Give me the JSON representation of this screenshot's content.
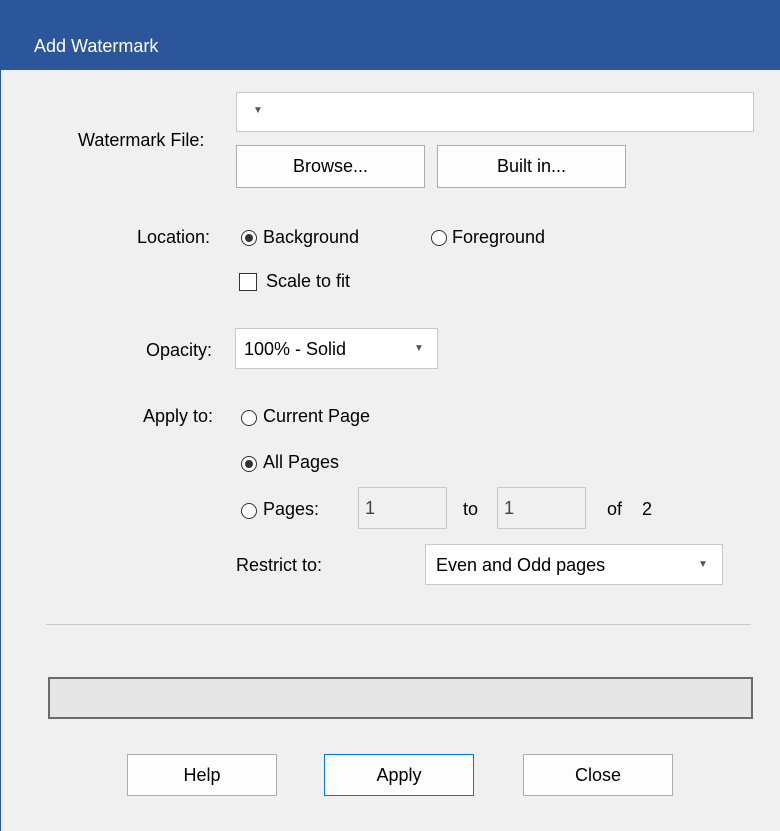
{
  "window": {
    "title": "Add Watermark"
  },
  "watermark_file": {
    "label": "Watermark File:",
    "value": ""
  },
  "buttons": {
    "browse": "Browse...",
    "built_in": "Built in...",
    "help": "Help",
    "apply": "Apply",
    "close": "Close"
  },
  "location": {
    "label": "Location:",
    "background": "Background",
    "foreground": "Foreground",
    "selected": "Background"
  },
  "scale_to_fit": {
    "label": "Scale to fit",
    "checked": false
  },
  "opacity": {
    "label": "Opacity:",
    "value": "100% - Solid"
  },
  "apply_to": {
    "label": "Apply to:",
    "current_page": "Current Page",
    "all_pages": "All Pages",
    "pages": "Pages:",
    "selected": "All Pages",
    "from_value": "1",
    "to_label": "to",
    "to_value": "1",
    "of_label": "of",
    "total_pages": "2"
  },
  "restrict": {
    "label": "Restrict to:",
    "value": "Even and Odd pages"
  },
  "colors": {
    "titlebar": "#2b579a",
    "accent": "#0078d7"
  }
}
